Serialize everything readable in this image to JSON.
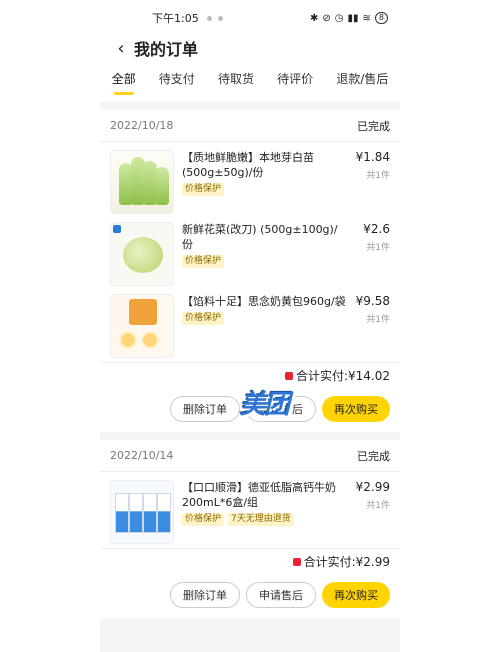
{
  "status_bar": {
    "time": "下午1:05",
    "battery": "8"
  },
  "header": {
    "title": "我的订单"
  },
  "tabs": [
    "全部",
    "待支付",
    "待取货",
    "待评价",
    "退款/售后"
  ],
  "orders": [
    {
      "date": "2022/10/18",
      "status": "已完成",
      "items": [
        {
          "name": "【质地鲜脆嫩】本地芽白苗(500g±50g)/份",
          "tags": [
            "价格保护"
          ],
          "price": "¥1.84",
          "qty": "共1件",
          "image": "bok-choy"
        },
        {
          "name": "新鲜花菜(改刀) (500g±100g)/份",
          "tags": [
            "价格保护"
          ],
          "price": "¥2.6",
          "qty": "共1件",
          "image": "cauliflower"
        },
        {
          "name": "【馅料十足】思念奶黄包960g/袋",
          "tags": [
            "价格保护"
          ],
          "price": "¥9.58",
          "qty": "共1件",
          "image": "custard-bun"
        }
      ],
      "total_label": "合计实付:",
      "total": "¥14.02",
      "buttons": {
        "delete": "删除订单",
        "after_sale": "申请售后",
        "rebuy": "再次购买"
      }
    },
    {
      "date": "2022/10/14",
      "status": "已完成",
      "items": [
        {
          "name": "【口口顺滑】德亚低脂高钙牛奶 200mL*6盒/组",
          "tags": [
            "价格保护",
            "7天无理由退货"
          ],
          "price": "¥2.99",
          "qty": "共1件",
          "image": "milk-cartons"
        }
      ],
      "total_label": "合计实付:",
      "total": "¥2.99",
      "buttons": {
        "delete": "删除订单",
        "after_sale": "申请售后",
        "rebuy": "再次购买"
      }
    }
  ],
  "watermark": "美团",
  "colors": {
    "accent": "#ffd400",
    "tag_bg": "#fff4c7",
    "page_bg": "#f4f4f4"
  }
}
